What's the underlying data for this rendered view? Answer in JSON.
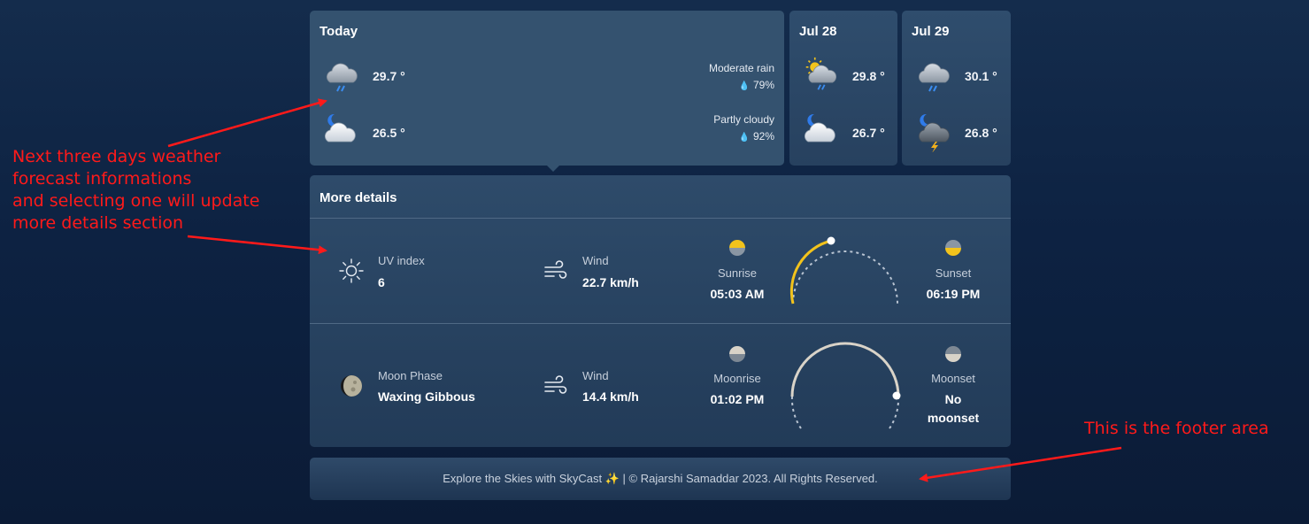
{
  "forecast": {
    "today": {
      "title": "Today",
      "day_temp": "29.7 °",
      "night_temp": "26.5 °",
      "day_condition": "Moderate rain",
      "day_humidity": "79%",
      "night_condition": "Partly cloudy",
      "night_humidity": "92%",
      "day_icon": "rain-cloud-icon",
      "night_icon": "moon-cloud-icon"
    },
    "days": [
      {
        "title": "Jul 28",
        "day_temp": "29.8 °",
        "night_temp": "26.7 °",
        "day_icon": "sun-rain-cloud-icon",
        "night_icon": "moon-cloud-icon"
      },
      {
        "title": "Jul 29",
        "day_temp": "30.1 °",
        "night_temp": "26.8 °",
        "day_icon": "rain-cloud-icon",
        "night_icon": "moon-thunder-icon"
      }
    ]
  },
  "details": {
    "title": "More details",
    "sun": {
      "uv_label": "UV index",
      "uv_value": "6",
      "wind_label": "Wind",
      "wind_value": "22.7 km/h",
      "rise_label": "Sunrise",
      "rise_value": "05:03 AM",
      "set_label": "Sunset",
      "set_value": "06:19 PM"
    },
    "moon": {
      "phase_label": "Moon Phase",
      "phase_value": "Waxing Gibbous",
      "wind_label": "Wind",
      "wind_value": "14.4 km/h",
      "rise_label": "Moonrise",
      "rise_value": "01:02 PM",
      "set_label": "Moonset",
      "set_value_line1": "No",
      "set_value_line2": "moonset"
    }
  },
  "footer": {
    "text": "Explore the Skies with SkyCast ✨ | © Rajarshi Samaddar 2023. All Rights Reserved."
  },
  "annotations": {
    "forecast_lines": [
      "Next three days weather",
      "forecast informations",
      "and selecting one will update",
      "more details section"
    ],
    "footer_note": "This is the footer area"
  },
  "colors": {
    "accent_sun": "#f2c31c",
    "annotation": "#ff1a1a",
    "arc_dash": "#b9c4d2",
    "moon_arc": "#d9d3c8"
  }
}
